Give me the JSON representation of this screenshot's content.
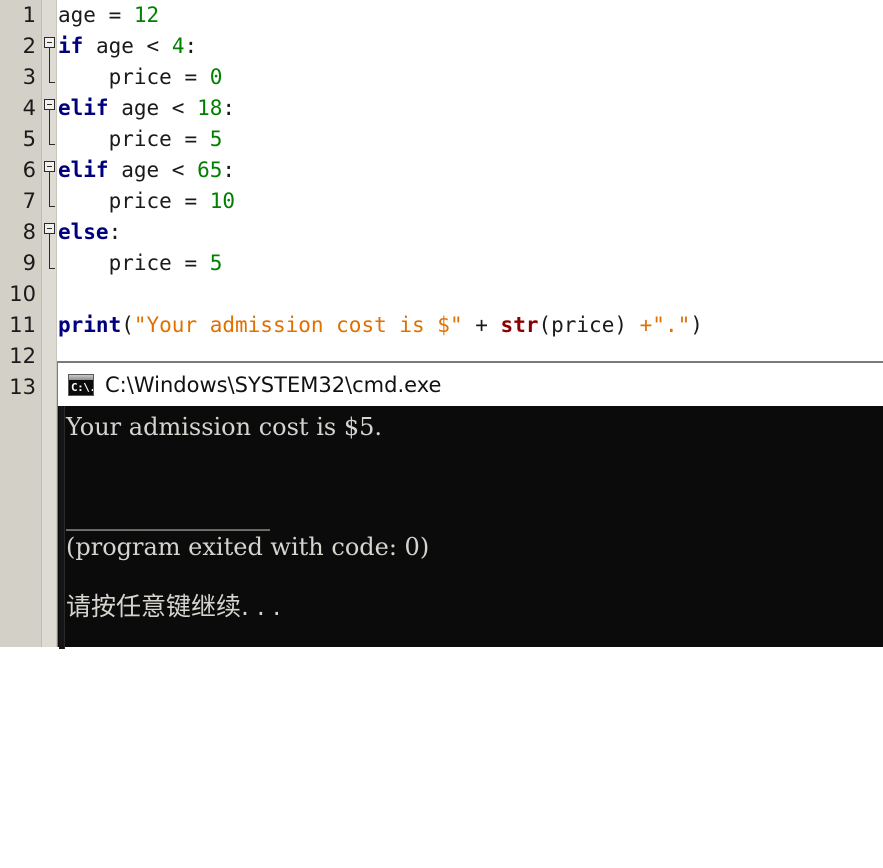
{
  "app": {
    "type": "python-code-editor-with-console"
  },
  "editor": {
    "gutter_line_numbers": [
      "1",
      "2",
      "3",
      "4",
      "5",
      "6",
      "7",
      "8",
      "9",
      "10",
      "11",
      "12",
      "13"
    ],
    "code_lines": [
      {
        "n": 1,
        "text": "age = 12"
      },
      {
        "n": 2,
        "text": "if age < 4:"
      },
      {
        "n": 3,
        "text": "    price = 0"
      },
      {
        "n": 4,
        "text": "elif age < 18:"
      },
      {
        "n": 5,
        "text": "    price = 5"
      },
      {
        "n": 6,
        "text": "elif age < 65:"
      },
      {
        "n": 7,
        "text": "    price = 10"
      },
      {
        "n": 8,
        "text": "else:"
      },
      {
        "n": 9,
        "text": "    price = 5"
      },
      {
        "n": 10,
        "text": ""
      },
      {
        "n": 11,
        "text": "print(\"Your admission cost is $\" + str(price) +\".\")"
      },
      {
        "n": 12,
        "text": ""
      },
      {
        "n": 13,
        "text": ""
      }
    ],
    "tokens": {
      "line1": {
        "var": "age",
        "op": "=",
        "value": "12"
      },
      "line2": {
        "keyword": "if",
        "condition": "age <",
        "value": "4",
        "colon": ":"
      },
      "line3": {
        "var": "price",
        "op": "=",
        "value": "0"
      },
      "line4": {
        "keyword": "elif",
        "condition": "age <",
        "value": "18",
        "colon": ":"
      },
      "line5": {
        "var": "price",
        "op": "=",
        "value": "5"
      },
      "line6": {
        "keyword": "elif",
        "condition": "age <",
        "value": "65",
        "colon": ":"
      },
      "line7": {
        "var": "price",
        "op": "=",
        "value": "10"
      },
      "line8": {
        "keyword": "else",
        "colon": ":"
      },
      "line9": {
        "var": "price",
        "op": "=",
        "value": "5"
      },
      "line11": {
        "keyword": "print",
        "open_paren": "(",
        "string1": "\"Your admission cost is $\"",
        "plus1": " + ",
        "func": "str",
        "args": "(price)",
        "plus2": " +",
        "string2": "\".\"",
        "close_paren": ")"
      }
    },
    "fold_markers": [
      {
        "line": 2,
        "state": "expanded"
      },
      {
        "line": 4,
        "state": "expanded"
      },
      {
        "line": 6,
        "state": "expanded"
      },
      {
        "line": 8,
        "state": "expanded"
      }
    ],
    "colors": {
      "keyword": "#00007F",
      "number": "#007F00",
      "string": "#E07000",
      "builtin_function": "#8B0000",
      "plain_text": "#1A1A1A",
      "gutter_background": "#D3D0C8",
      "editor_background": "#FFFFFF"
    }
  },
  "console": {
    "title": "C:\\Windows\\SYSTEM32\\cmd.exe",
    "icon": "cmd-icon",
    "icon_prompt": "C:\\.",
    "output_lines": [
      "Your admission cost is $5.",
      "",
      "",
      "_________________",
      "(program exited with code: 0)",
      "",
      "请按任意键继续. . ."
    ],
    "exit_code": "0",
    "colors": {
      "background": "#0B0B0B",
      "text": "#D6D4CF",
      "titlebar_background": "#FFFFFF"
    }
  }
}
